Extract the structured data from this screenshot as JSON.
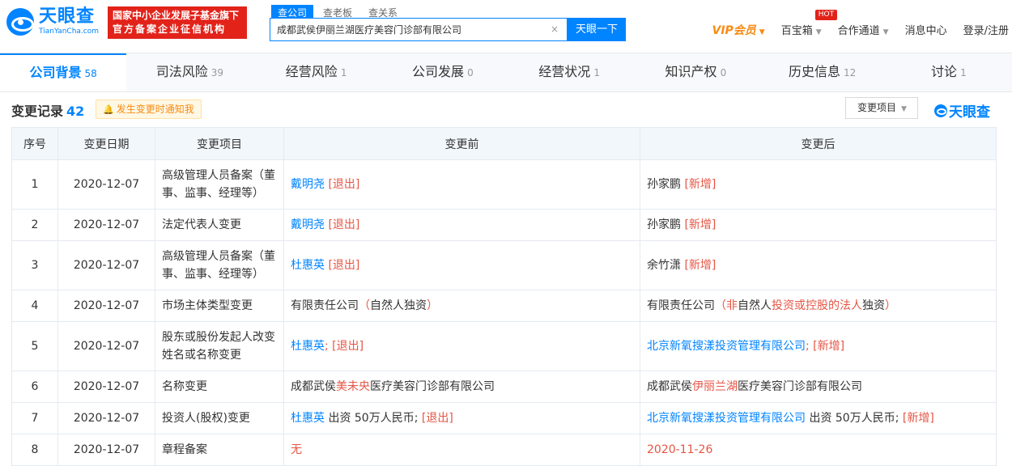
{
  "header": {
    "logo_cn": "天眼查",
    "logo_en": "TianYanCha.com",
    "badge_line1": "国家中小企业发展子基金旗下",
    "badge_line2": "官方备案企业征信机构",
    "search_tabs": [
      "查公司",
      "查老板",
      "查关系"
    ],
    "search_value": "成都武侯伊丽兰湖医疗美容门诊部有限公司",
    "search_clear": "×",
    "search_button": "天眼一下",
    "nav": {
      "vip": "VIP会员",
      "treasure": "百宝箱",
      "hot": "HOT",
      "partner": "合作通道",
      "messages": "消息中心",
      "login": "登录/注册"
    }
  },
  "tabs": [
    {
      "label": "公司背景",
      "count": "58"
    },
    {
      "label": "司法风险",
      "count": "39"
    },
    {
      "label": "经营风险",
      "count": "1"
    },
    {
      "label": "公司发展",
      "count": "0"
    },
    {
      "label": "经营状况",
      "count": "1"
    },
    {
      "label": "知识产权",
      "count": "0"
    },
    {
      "label": "历史信息",
      "count": "12"
    },
    {
      "label": "讨论",
      "count": "1"
    }
  ],
  "section": {
    "title": "变更记录",
    "count": "42",
    "notify": "发生变更时通知我",
    "filter": "变更项目",
    "brand": "天眼查"
  },
  "table": {
    "headers": [
      "序号",
      "变更日期",
      "变更项目",
      "变更前",
      "变更后"
    ],
    "rows": [
      {
        "no": "1",
        "date": "2020-12-07",
        "item": "高级管理人员备案（董事、监事、经理等）",
        "before": [
          {
            "t": "戴明尧",
            "s": "link"
          },
          {
            "t": " [退出]",
            "s": "tag"
          }
        ],
        "after": [
          {
            "t": "孙家鹏",
            "s": ""
          },
          {
            "t": " [新增]",
            "s": "tag"
          }
        ]
      },
      {
        "no": "2",
        "date": "2020-12-07",
        "item": "法定代表人变更",
        "before": [
          {
            "t": "戴明尧",
            "s": "link"
          },
          {
            "t": " [退出]",
            "s": "tag"
          }
        ],
        "after": [
          {
            "t": "孙家鹏",
            "s": ""
          },
          {
            "t": " [新增]",
            "s": "tag"
          }
        ]
      },
      {
        "no": "3",
        "date": "2020-12-07",
        "item": "高级管理人员备案（董事、监事、经理等）",
        "before": [
          {
            "t": "杜惠英",
            "s": "link"
          },
          {
            "t": " [退出]",
            "s": "tag"
          }
        ],
        "after": [
          {
            "t": "余竹潇",
            "s": ""
          },
          {
            "t": " [新增]",
            "s": "tag"
          }
        ]
      },
      {
        "no": "4",
        "date": "2020-12-07",
        "item": "市场主体类型变更",
        "before": [
          {
            "t": "有限责任公司",
            "s": ""
          },
          {
            "t": "（",
            "s": "red"
          },
          {
            "t": "自然人独资",
            "s": ""
          },
          {
            "t": "）",
            "s": "red"
          }
        ],
        "after": [
          {
            "t": "有限责任公司",
            "s": ""
          },
          {
            "t": "（非",
            "s": "red"
          },
          {
            "t": "自然人",
            "s": ""
          },
          {
            "t": "投资或控股的法人",
            "s": "red"
          },
          {
            "t": "独资",
            "s": ""
          },
          {
            "t": "）",
            "s": "red"
          }
        ]
      },
      {
        "no": "5",
        "date": "2020-12-07",
        "item": "股东或股份发起人改变姓名或名称变更",
        "before": [
          {
            "t": "杜惠英",
            "s": "link"
          },
          {
            "t": "; [退出]",
            "s": "tag"
          }
        ],
        "after": [
          {
            "t": "北京新氧搜漾投资管理有限公司",
            "s": "link"
          },
          {
            "t": "; [新增]",
            "s": "tag"
          }
        ]
      },
      {
        "no": "6",
        "date": "2020-12-07",
        "item": "名称变更",
        "before": [
          {
            "t": "成都武侯",
            "s": ""
          },
          {
            "t": "美未央",
            "s": "red"
          },
          {
            "t": "医疗美容门诊部有限公司",
            "s": ""
          }
        ],
        "after": [
          {
            "t": "成都武侯",
            "s": ""
          },
          {
            "t": "伊丽兰湖",
            "s": "red"
          },
          {
            "t": "医疗美容门诊部有限公司",
            "s": ""
          }
        ]
      },
      {
        "no": "7",
        "date": "2020-12-07",
        "item": "投资人(股权)变更",
        "before": [
          {
            "t": "杜惠英",
            "s": "link"
          },
          {
            "t": " 出资 50万人民币; ",
            "s": ""
          },
          {
            "t": "[退出]",
            "s": "tag"
          }
        ],
        "after": [
          {
            "t": "北京新氧搜漾投资管理有限公司",
            "s": "link"
          },
          {
            "t": " 出资 50万人民币; ",
            "s": ""
          },
          {
            "t": "[新增]",
            "s": "tag"
          }
        ]
      },
      {
        "no": "8",
        "date": "2020-12-07",
        "item": "章程备案",
        "before": [
          {
            "t": "无",
            "s": "red"
          }
        ],
        "after": [
          {
            "t": "2020-11-26",
            "s": "red"
          }
        ]
      }
    ]
  }
}
